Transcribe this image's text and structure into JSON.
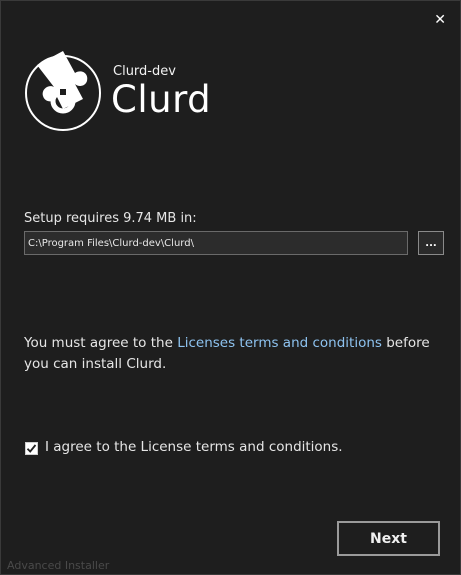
{
  "window": {
    "close_glyph": "✕"
  },
  "header": {
    "company": "Clurd-dev",
    "product": "Clurd",
    "logo_icon": "puzzle-piece-logo"
  },
  "location": {
    "label": "Setup requires 9.74 MB in:",
    "path_value": "C:\\Program Files\\Clurd-dev\\Clurd\\",
    "browse_label": "..."
  },
  "license": {
    "text_before": "You must agree to the ",
    "link_text": "Licenses terms and conditions",
    "text_after": " before you can install Clurd.",
    "checkbox_checked": true,
    "checkbox_label": "I agree to the License terms and conditions."
  },
  "actions": {
    "next_label": "Next"
  },
  "footer": {
    "brand": "Advanced Installer"
  },
  "colors": {
    "background": "#1e1e1e",
    "link": "#8ec3f0",
    "text": "#e6e6e6"
  }
}
